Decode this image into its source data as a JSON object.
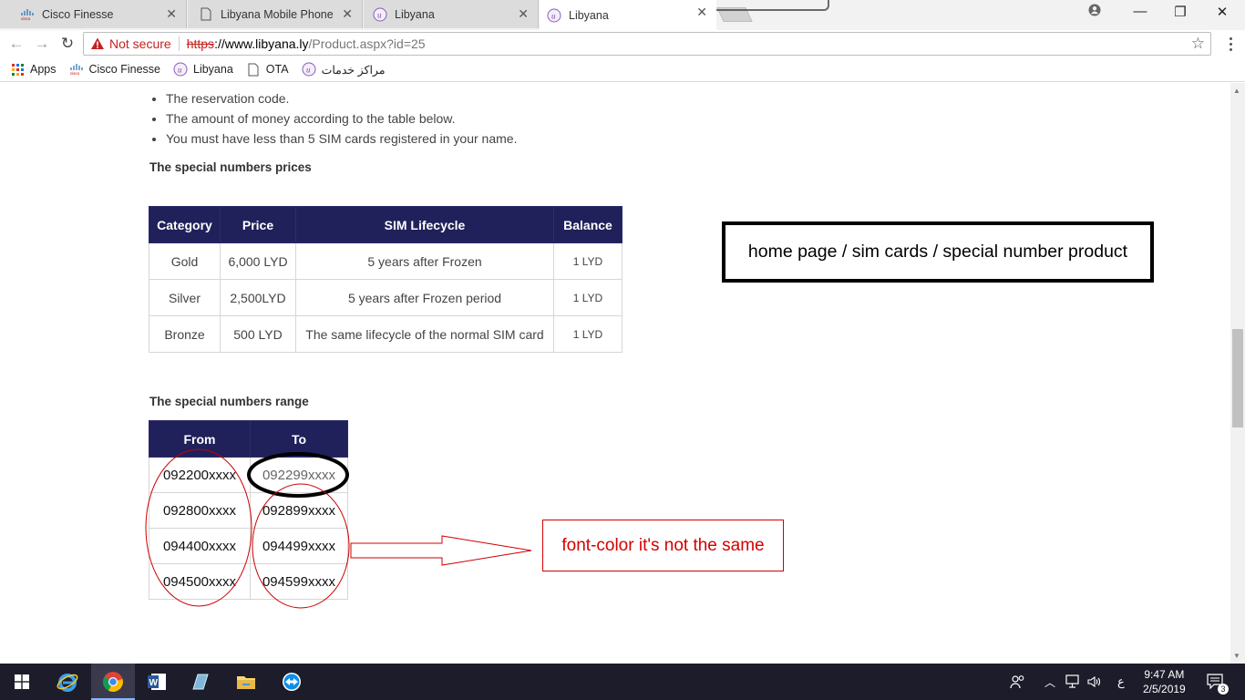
{
  "browser": {
    "tabs": [
      {
        "title": "Cisco Finesse",
        "icon": "cisco-icon"
      },
      {
        "title": "Libyana Mobile Phone",
        "icon": "document-icon"
      },
      {
        "title": "Libyana",
        "icon": "libyana-icon"
      },
      {
        "title": "Libyana",
        "icon": "libyana-icon",
        "active": true
      }
    ],
    "security_label": "Not secure",
    "url_protocol": "https",
    "url_host": "://www.libyana.ly",
    "url_path": "/Product.aspx?id=25",
    "bookmarks": [
      {
        "label": "Apps",
        "icon": "apps-grid-icon"
      },
      {
        "label": "Cisco Finesse",
        "icon": "cisco-icon"
      },
      {
        "label": "Libyana",
        "icon": "libyana-icon"
      },
      {
        "label": "OTA",
        "icon": "document-icon"
      },
      {
        "label": "مراكز خدمات",
        "icon": "libyana-icon"
      }
    ]
  },
  "page": {
    "requirements": [
      "The reservation code.",
      "The amount of money according to the table below.",
      "You must have less than 5 SIM cards registered in your name."
    ],
    "prices_heading": "The special numbers prices",
    "prices_table": {
      "headers": [
        "Category",
        "Price",
        "SIM Lifecycle",
        "Balance"
      ],
      "rows": [
        [
          "Gold",
          "6,000 LYD",
          "5 years after Frozen",
          "1 LYD"
        ],
        [
          "Silver",
          "2,500LYD",
          "5 years after Frozen period",
          "1 LYD"
        ],
        [
          "Bronze",
          "500 LYD",
          "The same lifecycle of the normal SIM card",
          "1 LYD"
        ]
      ]
    },
    "range_heading": "The special numbers range",
    "range_table": {
      "headers": [
        "From",
        "To"
      ],
      "rows": [
        [
          "092200xxxx",
          "092299xxxx"
        ],
        [
          "092800xxxx",
          "092899xxxx"
        ],
        [
          "094400xxxx",
          "094499xxxx"
        ],
        [
          "094500xxxx",
          "094599xxxx"
        ]
      ]
    },
    "breadcrumb_annotation": "home page / sim cards / special number product",
    "font_color_annotation": "font-color it's not the same"
  },
  "taskbar": {
    "time": "9:47 AM",
    "date": "2/5/2019",
    "language": "ع",
    "notifications": "3"
  },
  "colors": {
    "table_header": "#20205b",
    "annotation_red": "#d40000",
    "not_secure_red": "#c5221f"
  }
}
